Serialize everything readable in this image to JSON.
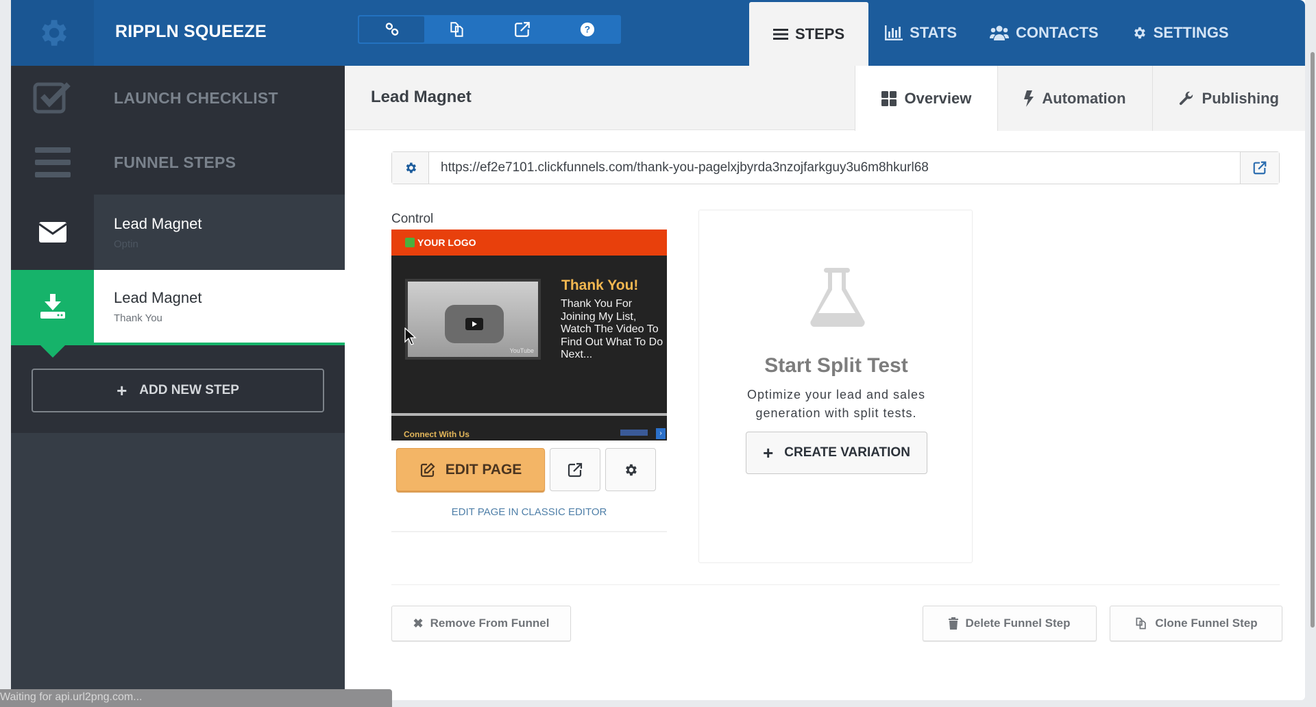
{
  "app": {
    "title": "RIPPLN SQUEEZE",
    "brand_color": "#1c5c9c",
    "accent_green": "#16b36a",
    "edit_color": "#f3b566"
  },
  "toolbar_icons": [
    {
      "icon": "link-icon",
      "active": true
    },
    {
      "icon": "copy-icon",
      "active": false
    },
    {
      "icon": "external-link-icon",
      "active": false
    },
    {
      "icon": "help-icon",
      "active": false
    }
  ],
  "nav": {
    "tabs": [
      {
        "label": "STEPS",
        "icon": "list-icon",
        "active": true
      },
      {
        "label": "STATS",
        "icon": "bar-chart-icon",
        "active": false
      },
      {
        "label": "CONTACTS",
        "icon": "users-icon",
        "active": false
      },
      {
        "label": "SETTINGS",
        "icon": "gear-icon",
        "active": false
      }
    ]
  },
  "sidebar": {
    "launch_checklist": "LAUNCH CHECKLIST",
    "funnel_steps": "FUNNEL STEPS",
    "steps": [
      {
        "name": "Lead Magnet",
        "type": "Optin",
        "icon": "envelope-icon",
        "selected": false
      },
      {
        "name": "Lead Magnet",
        "type": "Thank You",
        "icon": "download-icon",
        "selected": true
      }
    ],
    "add_step": "ADD NEW STEP"
  },
  "main": {
    "title": "Lead Magnet",
    "subtabs": [
      {
        "label": "Overview",
        "icon": "grid-icon",
        "active": true
      },
      {
        "label": "Automation",
        "icon": "bolt-icon",
        "active": false
      },
      {
        "label": "Publishing",
        "icon": "wrench-icon",
        "active": false
      }
    ],
    "url": "https://ef2e7101.clickfunnels.com/thank-you-pagelxjbyrda3nzojfarkguy3u6m8hkurl68",
    "control_label": "Control",
    "thumbnail": {
      "logo": "YOUR LOGO",
      "heading": "Thank You!",
      "body": "Thank You For Joining My List, Watch The Video To Find Out What To Do Next...",
      "video_brand": "YouTube",
      "footer": "Connect With Us"
    },
    "edit_page": "EDIT PAGE",
    "classic_editor": "EDIT PAGE IN CLASSIC EDITOR",
    "split_test": {
      "title": "Start Split Test",
      "description": "Optimize your lead and sales generation with split tests.",
      "button": "CREATE VARIATION"
    },
    "footer_buttons": {
      "remove": "Remove From Funnel",
      "delete": "Delete Funnel Step",
      "clone": "Clone Funnel Step"
    }
  },
  "status_bar": "Waiting for api.url2png.com..."
}
